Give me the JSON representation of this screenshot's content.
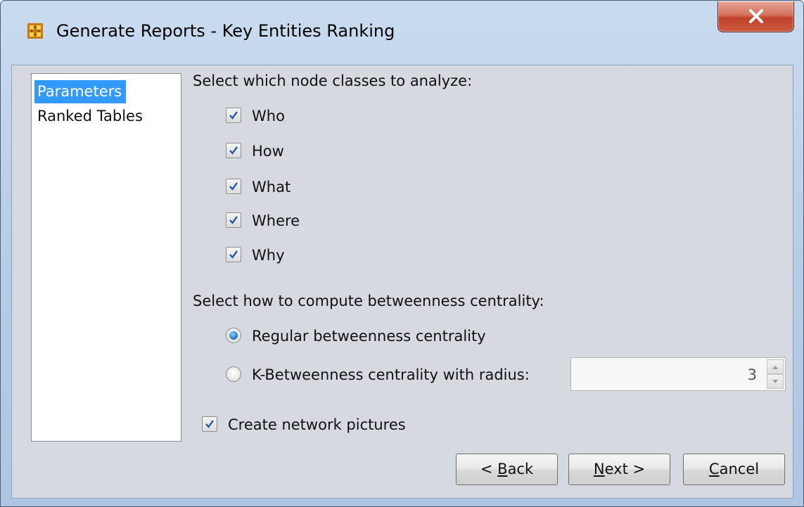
{
  "window": {
    "title": "Generate Reports - Key Entities Ranking"
  },
  "sidebar": {
    "items": [
      {
        "label": "Parameters",
        "selected": true
      },
      {
        "label": "Ranked Tables",
        "selected": false
      }
    ]
  },
  "node_classes": {
    "heading": "Select which node classes to analyze:",
    "options": [
      {
        "label": "Who",
        "checked": true
      },
      {
        "label": "How",
        "checked": true
      },
      {
        "label": "What",
        "checked": true
      },
      {
        "label": "Where",
        "checked": true
      },
      {
        "label": "Why",
        "checked": true
      }
    ]
  },
  "betweenness": {
    "heading": "Select how to compute betweenness centrality:",
    "regular_label": "Regular betweenness centrality",
    "regular_selected": true,
    "k_label": "K-Betweenness centrality with radius:",
    "k_selected": false,
    "radius_value": "3"
  },
  "network_pictures": {
    "label": "Create network pictures",
    "checked": true
  },
  "buttons": {
    "back_mnemonic": "B",
    "back_rest": "ack",
    "back_prefix": "< ",
    "next_mnemonic": "N",
    "next_rest": "ext >",
    "cancel_mnemonic": "C",
    "cancel_rest": "ancel"
  },
  "colors": {
    "selection": "#3399ff",
    "client_background": "#d6d9df",
    "close_button": "#c0432b"
  },
  "icons": {
    "app": "grid-network-icon",
    "close": "close-icon",
    "check": "checkmark-icon",
    "spin_up": "chevron-up-icon",
    "spin_down": "chevron-down-icon"
  }
}
